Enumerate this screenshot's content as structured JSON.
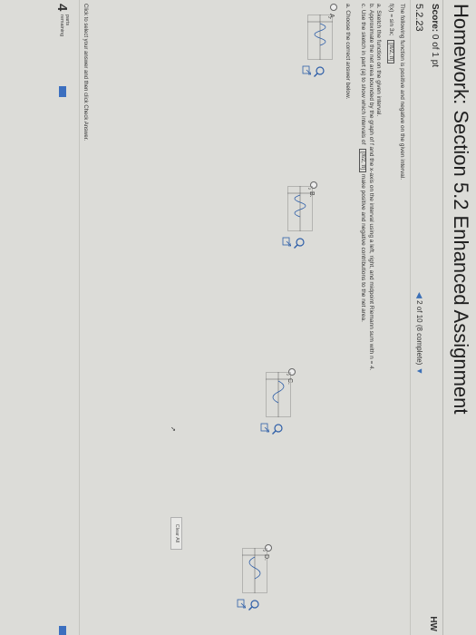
{
  "window": {
    "title": "Homework: Section 5.2 Enhanced Assignment"
  },
  "header": {
    "score_label": "Score:",
    "score_value": "0 of 1 pt",
    "right_label": "HW",
    "question_number": "5.2.23",
    "nav_text": "2 of 10 (8 complete)",
    "nav_prev_icon": "triangle-left-icon",
    "nav_next_icon": "triangle-right-icon"
  },
  "question": {
    "intro": "The following function is positive and negative on the given interval.",
    "function": "f(x) = sin 3x;",
    "interval": "[π/2, π]",
    "part_a": "a. Sketch the function on the given interval.",
    "part_b": "b. Approximate the net area bounded by the graph of f and the x-axis on the interval using a left, right, and midpoint Riemann sum with n = 4.",
    "part_c_1": "c. Use the sketch in part (a) to show which intervals of",
    "part_c_interval": "[π/2, π]",
    "part_c_2": "make positive and negative contributions to the net area.",
    "prompt": "a. Choose the correct answer below."
  },
  "choices": [
    {
      "letter": "A.",
      "selected": false
    },
    {
      "letter": "B.",
      "selected": false
    },
    {
      "letter": "C.",
      "selected": false
    },
    {
      "letter": "D.",
      "selected": false
    }
  ],
  "graph_labels": {
    "y_top": "2",
    "y_mid": "0",
    "x_a": "π",
    "x_b": "3π",
    "x_c": "2π",
    "frac_den": "2",
    "frac_den4": "4"
  },
  "footer": {
    "instruction": "Click to select your answer and then click Check Answer.",
    "parts_count": "4",
    "parts_label_1": "parts",
    "parts_label_2": "remaining",
    "clear_all": "Clear All"
  },
  "colors": {
    "accent": "#3c6fbf",
    "page": "#dcdcd8"
  }
}
